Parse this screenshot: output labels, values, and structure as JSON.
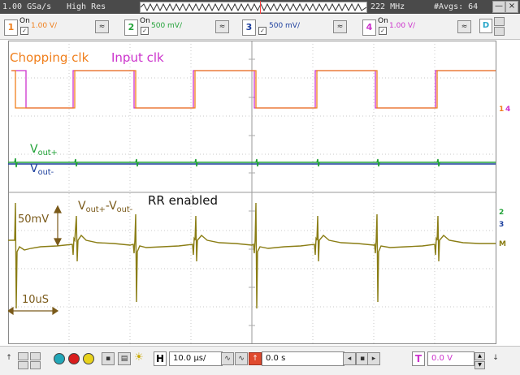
{
  "status_bar": {
    "sample_rate": "1.00 GSa/s",
    "acq_mode": "High Res",
    "bandwidth": "222 MHz",
    "averages": "#Avgs: 64",
    "minimize": "—",
    "close": "×"
  },
  "channels": [
    {
      "num": "1",
      "on": "On",
      "scale": "1.00 V/",
      "color": "#f07f1c"
    },
    {
      "num": "2",
      "on": "On",
      "scale": "500 mV/",
      "color": "#22a238"
    },
    {
      "num": "3",
      "on": "On",
      "scale": "500 mV/",
      "color": "#1d3f9e"
    },
    {
      "num": "4",
      "on": "On",
      "scale": "1.00 V/",
      "color": "#cc33cc"
    }
  ],
  "check_mark": "✓",
  "coupling_icon": "≈",
  "d_button": "D",
  "annotations": {
    "chopping_clk": "Chopping clk",
    "input_clk": "Input clk",
    "vout_p": "V",
    "vout_p_sub": "out+",
    "vout_m": "V",
    "vout_m_sub": "out-",
    "vdiff_a": "V",
    "vdiff_a_sub": "out+",
    "vdiff_dash": "-V",
    "vdiff_b_sub": "out-",
    "rr_enabled": "RR enabled",
    "amp_scale": "50mV",
    "time_scale": "10uS"
  },
  "right_markers": [
    "1",
    "4",
    "2",
    "3",
    "M"
  ],
  "bottom_bar": {
    "h_label": "H",
    "h_scale": "10.0 µs/",
    "delay": "0.0 s",
    "t_label": "T",
    "trigger_level": "0.0 V"
  },
  "colors": {
    "ch1": "#f07f1c",
    "ch2": "#22a238",
    "ch3": "#1d3f9e",
    "ch4": "#cc33cc",
    "math": "#8a7d14",
    "annotation": "#7a5a1a"
  }
}
